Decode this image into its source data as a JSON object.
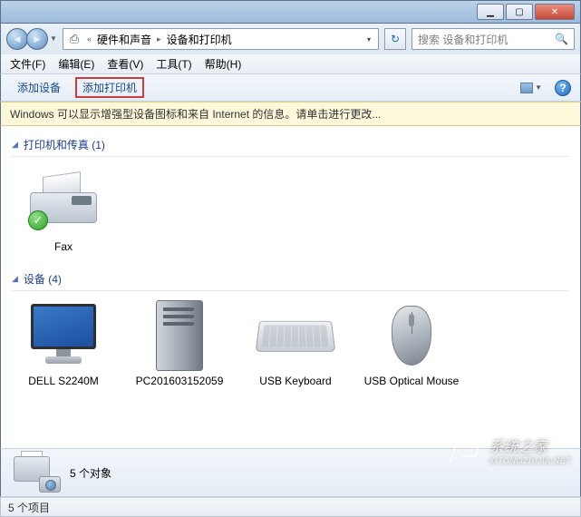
{
  "address": {
    "crumb1": "硬件和声音",
    "crumb2": "设备和打印机"
  },
  "search": {
    "placeholder": "搜索 设备和打印机"
  },
  "menu": {
    "file": "文件(F)",
    "edit": "编辑(E)",
    "view": "查看(V)",
    "tools": "工具(T)",
    "help": "帮助(H)"
  },
  "toolbar": {
    "add_device": "添加设备",
    "add_printer": "添加打印机"
  },
  "infobar": "Windows 可以显示增强型设备图标和来自 Internet 的信息。请单击进行更改...",
  "groups": {
    "printers": {
      "title": "打印机和传真 (1)"
    },
    "devices": {
      "title": "设备 (4)"
    }
  },
  "items": {
    "fax": "Fax",
    "monitor": "DELL S2240M",
    "pc": "PC201603152059",
    "keyboard": "USB Keyboard",
    "mouse": "USB Optical Mouse"
  },
  "details": {
    "count": "5 个对象"
  },
  "status": {
    "text": "5 个项目"
  },
  "watermark": {
    "text": "系统之家",
    "sub": "XITONGZHIJIA.NET"
  }
}
